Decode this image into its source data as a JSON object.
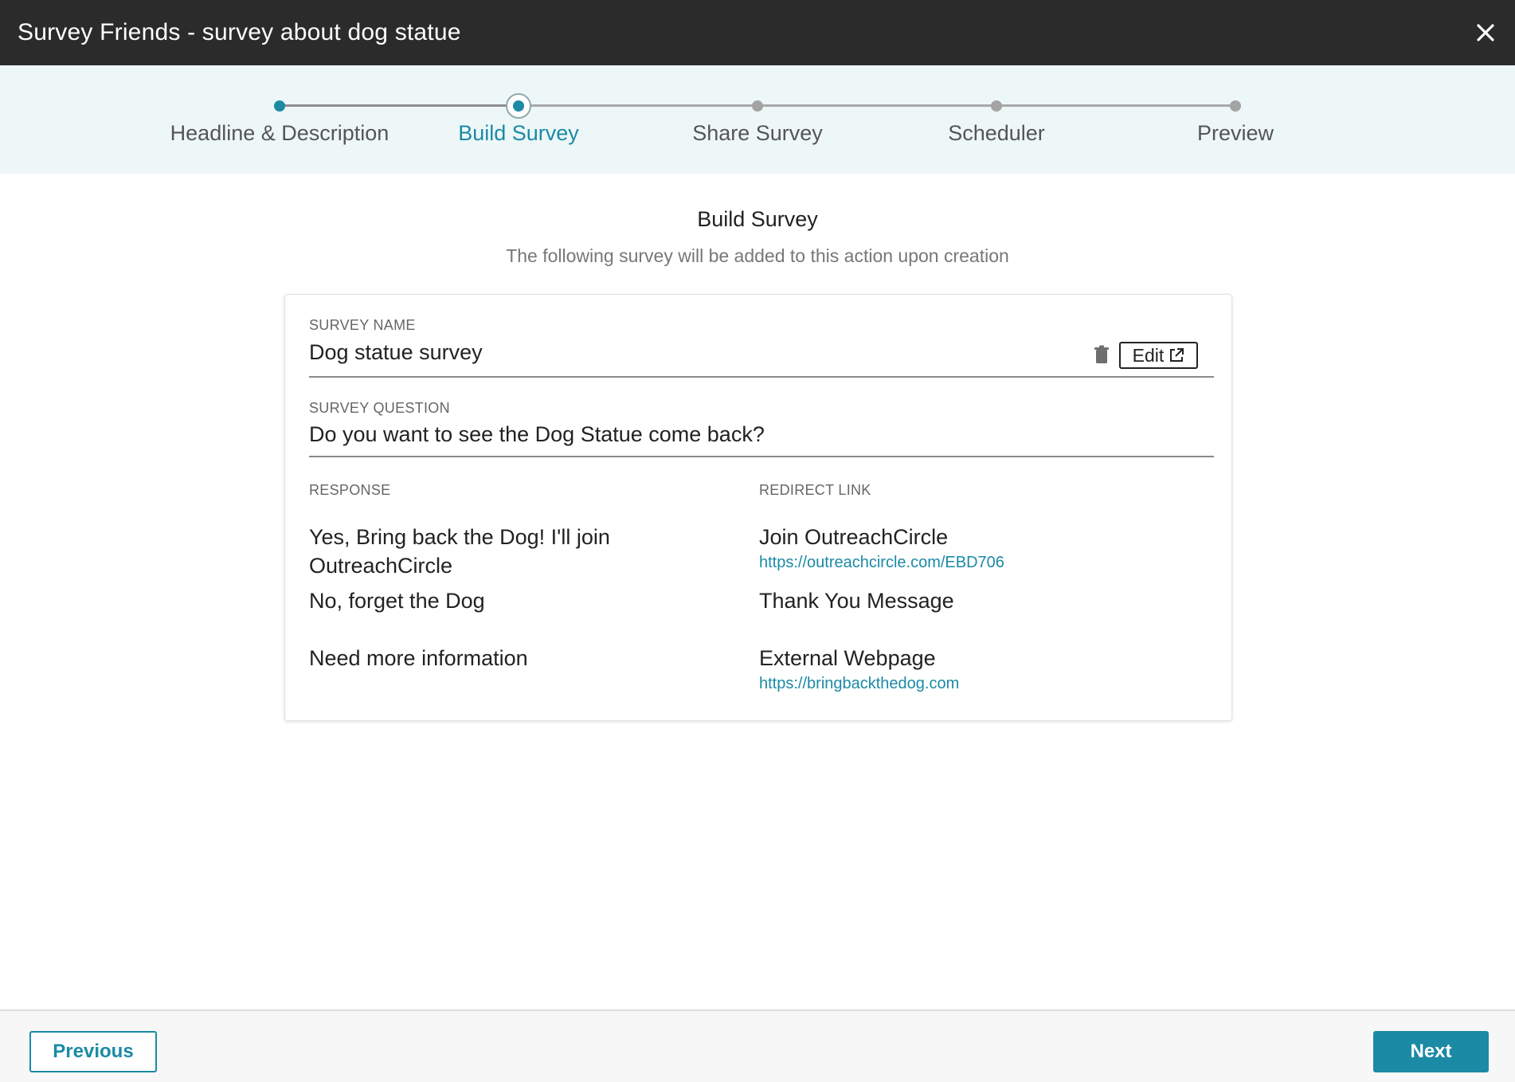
{
  "header": {
    "title": "Survey Friends - survey about dog statue",
    "close_icon": "close-icon"
  },
  "stepper": {
    "current_index": 1,
    "steps": [
      {
        "label": "Headline & Description",
        "state": "done"
      },
      {
        "label": "Build Survey",
        "state": "current"
      },
      {
        "label": "Share Survey",
        "state": "upcoming"
      },
      {
        "label": "Scheduler",
        "state": "upcoming"
      },
      {
        "label": "Preview",
        "state": "upcoming"
      }
    ]
  },
  "main": {
    "title": "Build Survey",
    "subtitle": "The following survey will be added to this action upon creation"
  },
  "survey": {
    "name_label": "SURVEY NAME",
    "name_value": "Dog statue survey",
    "question_label": "SURVEY QUESTION",
    "question_value": "Do you want to see the Dog Statue come back?",
    "delete_icon": "trash-icon",
    "edit_label": "Edit",
    "edit_icon": "external-link-icon",
    "response_header": "RESPONSE",
    "redirect_header": "REDIRECT LINK",
    "rows": [
      {
        "response": "Yes, Bring back the Dog! I'll join OutreachCircle",
        "redirect": "Join OutreachCircle",
        "url": "https://outreachcircle.com/EBD706"
      },
      {
        "response": "No, forget the Dog",
        "redirect": "Thank You Message",
        "url": ""
      },
      {
        "response": "Need more information",
        "redirect": "External Webpage",
        "url": "https://bringbackthedog.com"
      }
    ]
  },
  "footer": {
    "previous_label": "Previous",
    "next_label": "Next"
  },
  "colors": {
    "accent": "#1b8aa5",
    "header_bg": "#2b2b2b",
    "stepper_bg": "#eef7f8"
  }
}
